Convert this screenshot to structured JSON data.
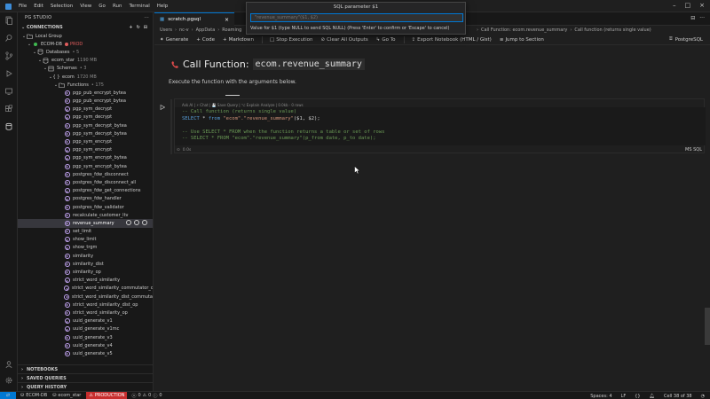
{
  "window": {
    "menu": [
      "File",
      "Edit",
      "Selection",
      "View",
      "Go",
      "Run",
      "Terminal",
      "Help"
    ],
    "title": "SQL parameter $1"
  },
  "sidebar": {
    "title": "PG STUDIO",
    "connections_label": "CONNECTIONS",
    "group_label": "Local Group",
    "connection_name": "ECOM-DB",
    "connection_badge": "PROD",
    "databases_label": "Databases",
    "databases_count": "• 5",
    "db_name": "ecom_star",
    "db_size": "1190 MB",
    "schemas_label": "Schemas",
    "schemas_count": "• 3",
    "schema_name": "ecom",
    "schema_size": "1720 MB",
    "functions_label": "Functions",
    "functions_count": "• 175",
    "functions": [
      "pgp_pub_encrypt_bytea",
      "pgp_pub_encrypt_bytea",
      "pgp_sym_decrypt",
      "pgp_sym_decrypt",
      "pgp_sym_decrypt_bytea",
      "pgp_sym_decrypt_bytea",
      "pgp_sym_encrypt",
      "pgp_sym_encrypt",
      "pgp_sym_encrypt_bytea",
      "pgp_sym_encrypt_bytea",
      "postgres_fdw_disconnect",
      "postgres_fdw_disconnect_all",
      "postgres_fdw_get_connections",
      "postgres_fdw_handler",
      "postgres_fdw_validator",
      "recalculate_customer_ltv",
      "revenue_summary",
      "set_limit",
      "show_limit",
      "show_trgm",
      "similarity",
      "similarity_dist",
      "similarity_op",
      "strict_word_similarity",
      "strict_word_similarity_commutator_op",
      "strict_word_similarity_dist_commutator_op",
      "strict_word_similarity_dist_op",
      "strict_word_similarity_op",
      "uuid_generate_v1",
      "uuid_generate_v1mc",
      "uuid_generate_v3",
      "uuid_generate_v4",
      "uuid_generate_v5"
    ],
    "selected_function": "revenue_summary",
    "bottom_sections": [
      "NOTEBOOKS",
      "SAVED QUERIES",
      "QUERY HISTORY"
    ]
  },
  "tabs": {
    "active": "scratch.pgsql"
  },
  "breadcrumb": {
    "left": [
      "Users",
      "nc-v",
      "AppData",
      "Roaming"
    ],
    "right": [
      "Call Function: ecom.revenue_summary",
      "Call function (returns single value)"
    ]
  },
  "toolbar": {
    "items": [
      "Generate",
      "Code",
      "Markdown",
      "Stop Execution",
      "Clear All Outputs",
      "Go To",
      "Export Notebook (HTML / Gist)",
      "Jump to Section"
    ],
    "kernel": "PostgreSQL"
  },
  "notebook": {
    "heading_prefix": "Call Function:",
    "heading_code": "ecom.revenue_summary",
    "description": "Execute the function with the arguments below.",
    "cell_toolbar": "Ask AI | ⚡ Chat | 💾 Save Query | ⌥ Explain Analyze | 0.0kb · 0 rows",
    "code_lines": [
      {
        "parts": [
          {
            "t": "-- Call function (returns single value)",
            "c": "c-comment"
          }
        ]
      },
      {
        "parts": [
          {
            "t": "SELECT",
            "c": "c-kw"
          },
          {
            "t": " * ",
            "c": "c-plain"
          },
          {
            "t": "from",
            "c": "c-kw"
          },
          {
            "t": " ",
            "c": "c-plain"
          },
          {
            "t": "\"ecom\".\"revenue_summary\"",
            "c": "c-str"
          },
          {
            "t": "($1, $2);",
            "c": "c-plain"
          }
        ]
      },
      {
        "parts": [
          {
            "t": "",
            "c": "c-plain"
          }
        ]
      },
      {
        "parts": [
          {
            "t": "-- Use SELECT * FROM when the function returns a table or set of rows",
            "c": "c-comment"
          }
        ]
      },
      {
        "parts": [
          {
            "t": "-- SELECT * FROM \"ecom\".\"revenue_summary\"(p_from date, p_to date);",
            "c": "c-comment"
          }
        ]
      }
    ],
    "cell_status": "0.0s",
    "cell_language": "MS SQL"
  },
  "quick_input": {
    "title": "SQL parameter $1",
    "placeholder": "\"revenue_summary\"($1, $2)",
    "message": "Value for $1 (type NULL to send SQL NULL) (Press 'Enter' to confirm or 'Escape' to cancel)"
  },
  "statusbar": {
    "connection": "ECOM-DB",
    "database": "ecom_star",
    "env": "PRODUCTION",
    "errors": "0",
    "warnings": "0",
    "info": "0",
    "spaces": "Spaces: 4",
    "encoding": "LF",
    "cell": "Cell 38 of 38"
  }
}
